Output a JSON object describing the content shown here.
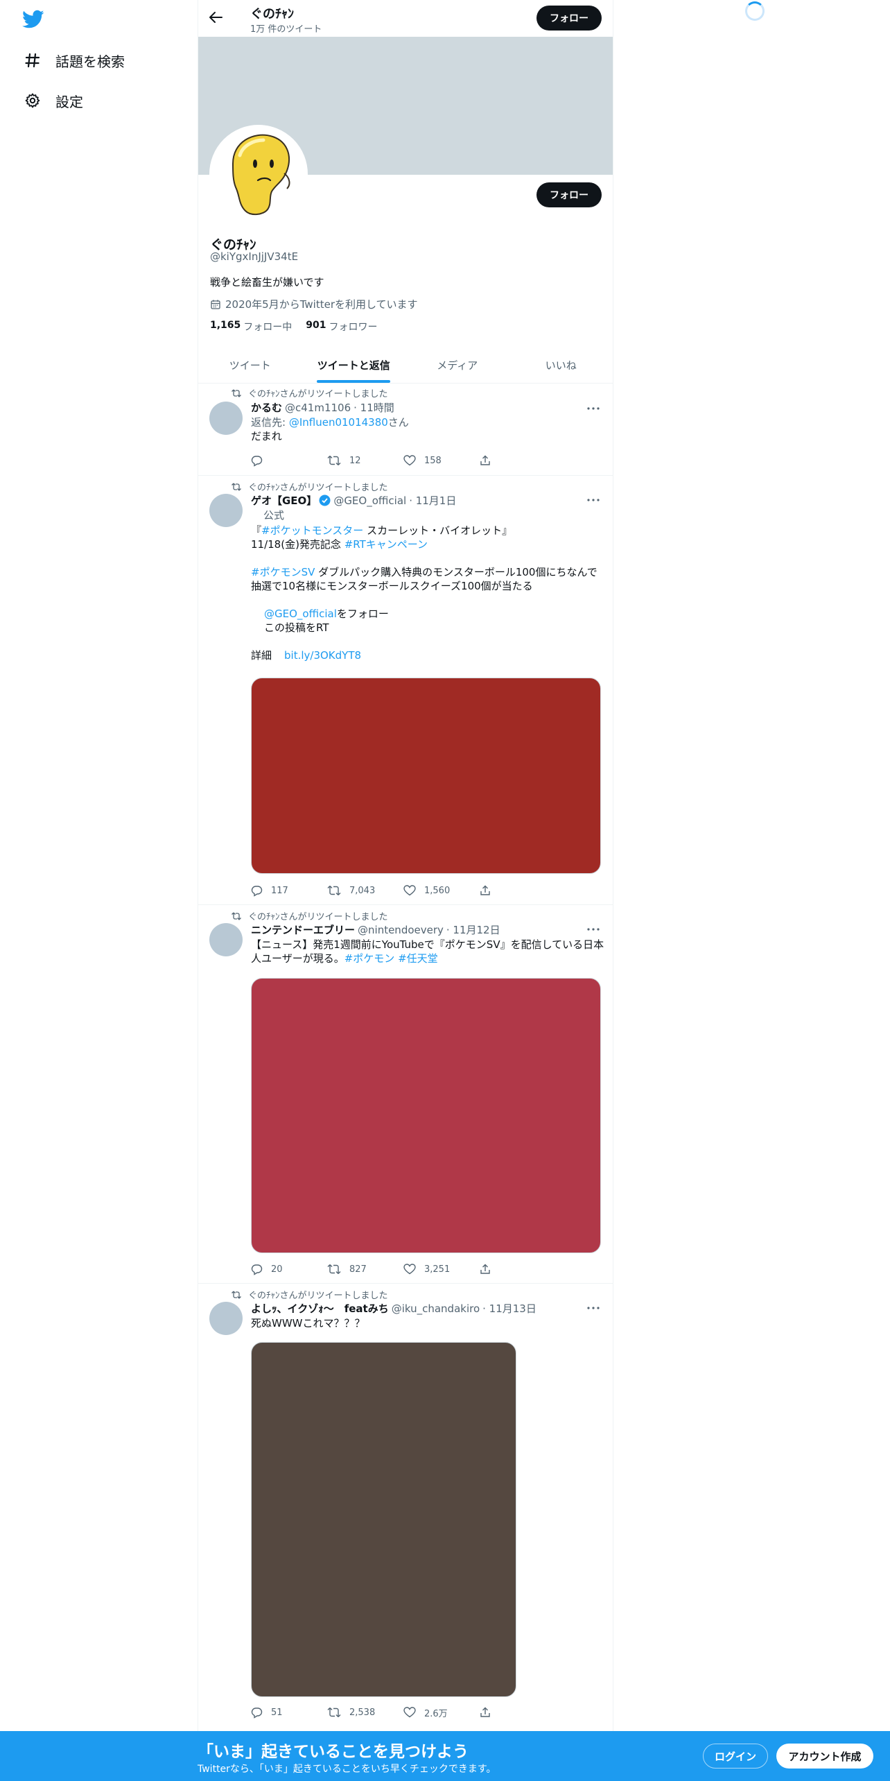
{
  "sidebar": {
    "logo_icon": "twitter-bird-icon",
    "items": [
      {
        "label": "話題を検索",
        "icon": "hashtag-icon"
      },
      {
        "label": "設定",
        "icon": "gear-icon"
      }
    ]
  },
  "header": {
    "name": "ぐのﾁｬﾝ",
    "tweet_count": "1万 件のツイート",
    "follow_label": "フォロー"
  },
  "profile": {
    "name": "ぐのﾁｬﾝ",
    "handle": "@kiYgxInJjJV34tE",
    "bio": "戦争と絵畜生が嫌いです",
    "joined": "2020年5月からTwitterを利用しています",
    "following_count": "1,165",
    "following_label": "フォロー中",
    "followers_count": "901",
    "followers_label": "フォロワー",
    "follow_label": "フォロー"
  },
  "tabs": [
    {
      "label": "ツイート",
      "active": false
    },
    {
      "label": "ツイートと返信",
      "active": true
    },
    {
      "label": "メディア",
      "active": false
    },
    {
      "label": "いいね",
      "active": false
    }
  ],
  "colors": {
    "accent": "#1d9bf0",
    "media1": "#a02a24",
    "media2": "#b03848",
    "media3": "#554840"
  },
  "tweets": [
    {
      "retweet_label": "ぐのﾁｬﾝさんがリツイートしました",
      "name": "かるむ",
      "handle": "@c41m1106",
      "time": "· 11時間",
      "reply_prefix": "返信先: ",
      "reply_to": "@Influen01014380",
      "reply_suffix": "さん",
      "text": "だまれ",
      "replies": "",
      "retweets": "12",
      "likes": "158"
    },
    {
      "retweet_label": "ぐのﾁｬﾝさんがリツイートしました",
      "name": "ゲオ【GEO】",
      "handle": "@GEO_official",
      "time": "· 11月1日",
      "official_label": "公式",
      "line1_pre": "『",
      "line1_tag": "#ポケットモンスター",
      "line1_post": " スカーレット・バイオレット』",
      "line2_pre": "11/18(金)発売記念 ",
      "line2_tag": "#RTキャンペーン",
      "line3_tag": "#ポケモンSV",
      "line3_post": " ダブルパック購入特典のモンスターボール100個にちなんで",
      "line4": "抽選で10名様にモンスターボールスクイーズ100個が当たる",
      "step1_link": "@GEO_official",
      "step1_post": "をフォロー",
      "step2": "この投稿をRT",
      "detail_label": "詳細",
      "detail_link": "bit.ly/3OKdYT8",
      "replies": "117",
      "retweets": "7,043",
      "likes": "1,560"
    },
    {
      "retweet_label": "ぐのﾁｬﾝさんがリツイートしました",
      "name": "ニンテンドーエブリー",
      "handle": "@nintendoevery",
      "time": "· 11月12日",
      "line1": "【ニュース】発売1週間前にYouTubeで『ポケモンSV』を配信している日本",
      "line2_pre": "人ユーザーが現る。",
      "tag1": "#ポケモン",
      "tag2": "#任天堂",
      "replies": "20",
      "retweets": "827",
      "likes": "3,251"
    },
    {
      "retweet_label": "ぐのﾁｬﾝさんがリツイートしました",
      "name": "よしｯ、イクゾｫ〜　featみち",
      "handle": "@iku_chandakiro",
      "time": "· 11月13日",
      "text": "死ぬWWWこれマ？？？",
      "replies": "51",
      "retweets": "2,538",
      "likes": "2.6万"
    }
  ],
  "bottom_bar": {
    "title": "「いま」起きていることを見つけよう",
    "subtitle": "Twitterなら、「いま」起きていることをいち早くチェックできます。",
    "login_label": "ログイン",
    "signup_label": "アカウント作成"
  }
}
